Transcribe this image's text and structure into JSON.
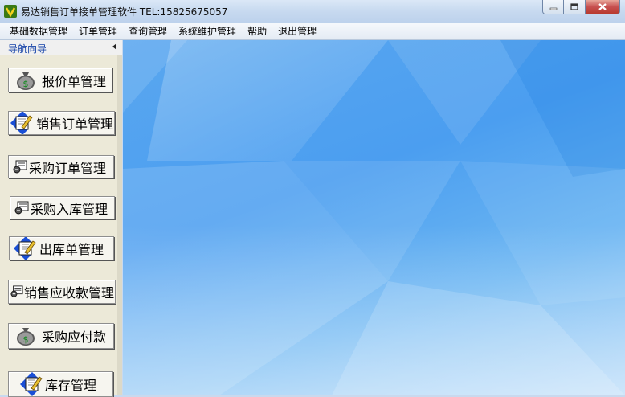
{
  "window": {
    "title": "易达销售订单接单管理软件  TEL:15825675057"
  },
  "menu": [
    "基础数据管理",
    "订单管理",
    "查询管理",
    "系统维护管理",
    "帮助",
    "退出管理"
  ],
  "sidebar": {
    "header": "导航向导",
    "buttons": [
      {
        "label": "报价单管理",
        "icon": "money-bag-icon"
      },
      {
        "label": "销售订单管理",
        "icon": "edit-document-arrows-icon"
      },
      {
        "label": "采购订单管理",
        "icon": "form-icon"
      },
      {
        "label": "采购入库管理",
        "icon": "form-icon"
      },
      {
        "label": "出库单管理",
        "icon": "edit-document-arrows-icon"
      },
      {
        "label": "销售应收款管理",
        "icon": "form-icon"
      },
      {
        "label": "采购应付款",
        "icon": "money-bag-icon"
      },
      {
        "label": "库存管理",
        "icon": "edit-document-arrows-icon"
      }
    ]
  },
  "colors": {
    "desktop_accent": "#4b9ef0",
    "nav_title": "#1542a8",
    "close_button": "#c75050"
  }
}
